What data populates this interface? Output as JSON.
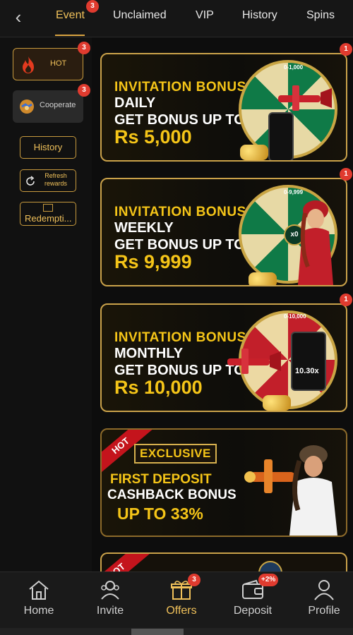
{
  "topnav": {
    "tabs": [
      {
        "label": "Event",
        "active": true,
        "badge": "3"
      },
      {
        "label": "Unclaimed"
      },
      {
        "label": "VIP"
      },
      {
        "label": "History"
      },
      {
        "label": "Spins"
      }
    ]
  },
  "sidebar": {
    "hot": {
      "label": "HOT",
      "badge": "3"
    },
    "cooperate": {
      "label": "Cooperate",
      "badge": "3"
    },
    "history_label": "History",
    "refresh_label": "Refresh rewards",
    "redemption_label": "Redempti..."
  },
  "banners": [
    {
      "badge": "1",
      "line1": "INVITATION BONUS",
      "line2": "DAILY",
      "line3": "GET BONUS UP TO",
      "line4": "Rs 5,000",
      "wheel_label": "0-1,000",
      "theme": "green"
    },
    {
      "badge": "1",
      "line1": "INVITATION BONUS",
      "line2": "WEEKLY",
      "line3": "GET BONUS UP TO",
      "line4": "Rs 9,999",
      "wheel_label": "0-9,999",
      "wheel_center": "x0",
      "theme": "green"
    },
    {
      "badge": "1",
      "line1": "INVITATION BONUS",
      "line2": "MONTHLY",
      "line3": "GET BONUS UP TO",
      "line4": "Rs 10,000",
      "wheel_label": "0-10,000",
      "phone_text": "10.30x",
      "theme": "red"
    }
  ],
  "cashback": {
    "tag": "HOT",
    "exclusive": "EXCLUSIVE",
    "line1": "FIRST DEPOSIT",
    "line2": "CASHBACK BONUS",
    "line3": "UP TO 33%"
  },
  "partial_banner": {
    "tag": "HOT"
  },
  "bottomnav": {
    "items": [
      {
        "label": "Home",
        "icon": "home-icon"
      },
      {
        "label": "Invite",
        "icon": "invite-icon"
      },
      {
        "label": "Offers",
        "icon": "gift-icon",
        "badge": "3",
        "active": true
      },
      {
        "label": "Deposit",
        "icon": "wallet-icon",
        "badge": "+2%"
      },
      {
        "label": "Profile",
        "icon": "profile-icon"
      }
    ]
  },
  "colors": {
    "accent": "#f0c15a",
    "badge": "#e03b2f",
    "gold_border": "#caa24a"
  }
}
